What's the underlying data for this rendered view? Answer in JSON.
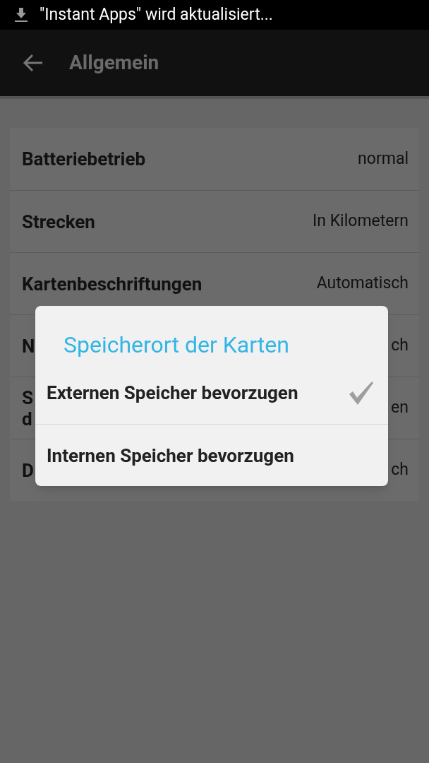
{
  "status_bar": {
    "notification": "\"Instant Apps\" wird aktualisiert..."
  },
  "toolbar": {
    "title": "Allgemein"
  },
  "settings": [
    {
      "title": "Batteriebetrieb",
      "value": "normal"
    },
    {
      "title": "Strecken",
      "value": "In Kilometern"
    },
    {
      "title": "Kartenbeschriftungen",
      "value": "Automatisch"
    },
    {
      "title": "N",
      "value": "ch"
    },
    {
      "title": "S\nd",
      "value": "en"
    },
    {
      "title": "D",
      "value": "ch"
    }
  ],
  "dialog": {
    "title": "Speicherort der Karten",
    "options": [
      {
        "label": "Externen Speicher bevorzugen",
        "selected": true
      },
      {
        "label": "Internen Speicher bevorzugen",
        "selected": false
      }
    ]
  }
}
